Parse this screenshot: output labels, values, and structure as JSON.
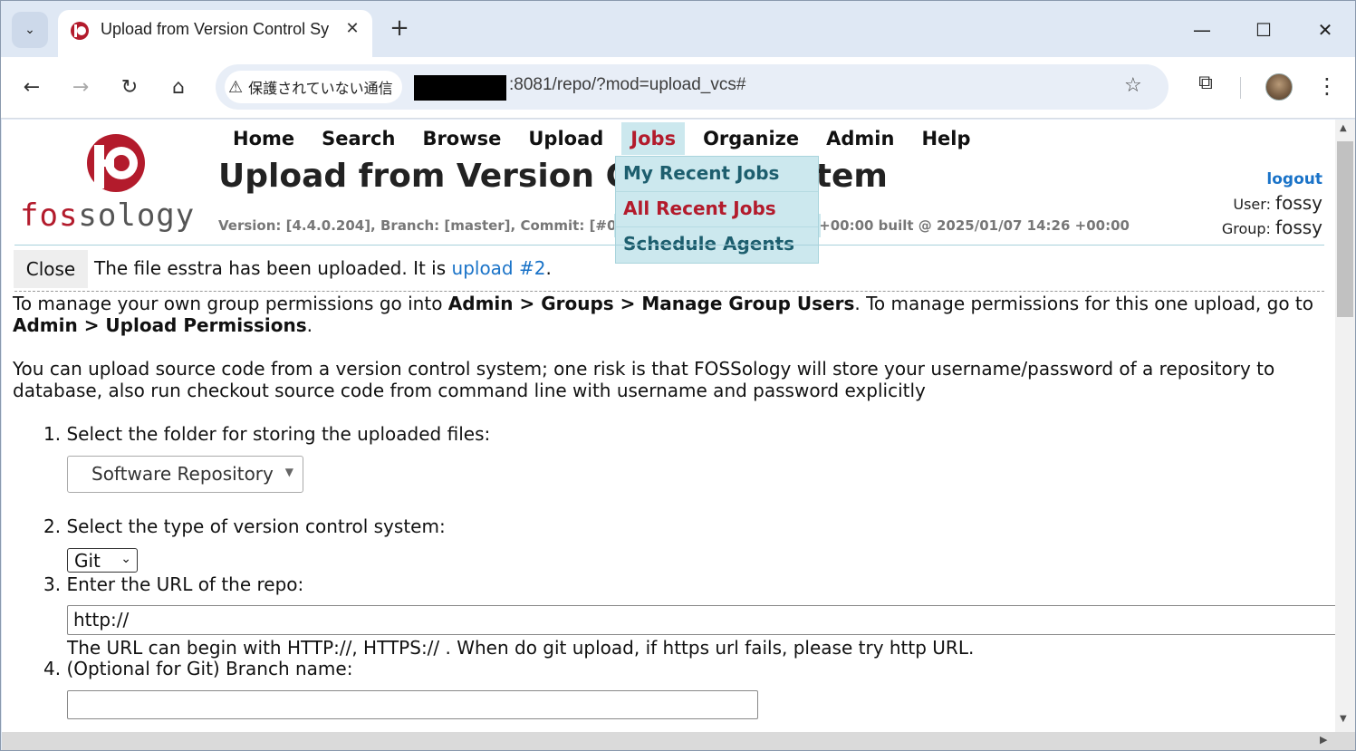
{
  "browser": {
    "tab_title": "Upload from Version Control Sy",
    "security_label": "保護されていない通信",
    "url": ":8081/repo/?mod=upload_vcs#",
    "new_tab": "+",
    "close_tab": "✕"
  },
  "nav": {
    "items": [
      {
        "label": "Home"
      },
      {
        "label": "Search"
      },
      {
        "label": "Browse"
      },
      {
        "label": "Upload"
      },
      {
        "label": "Jobs"
      },
      {
        "label": "Organize"
      },
      {
        "label": "Admin"
      },
      {
        "label": "Help"
      }
    ],
    "jobs_menu": [
      {
        "label": "My Recent Jobs"
      },
      {
        "label": "All Recent Jobs"
      },
      {
        "label": "Schedule Agents"
      }
    ]
  },
  "logo": {
    "text_red": "fos",
    "text_gray": "sology"
  },
  "header": {
    "title": "Upload from Version Control System",
    "version": "Version: [4.4.0.204], Branch: [master], Commit: [#0dfa0d1] 2025/01/07 14:13 +00:00 built @ 2025/01/07 14:26 +00:00",
    "logout": "logout",
    "user_label": "User:",
    "user": "fossy",
    "group_label": "Group:",
    "group": "fossy"
  },
  "notice": {
    "close_label": "Close",
    "text": "The file esstra has been uploaded. It is ",
    "link": "upload #2",
    "end": "."
  },
  "intro": {
    "p1_a": "To manage your own group permissions go into ",
    "p1_b": "Admin > Groups > Manage Group Users",
    "p1_c": ". To manage permissions for this one upload, go to ",
    "p1_d": "Admin > Upload Permissions",
    "p1_e": ".",
    "p2": "You can upload source code from a version control system; one risk is that FOSSology will store your username/password of a repository to database, also run checkout source code from command line with username and password explicitly"
  },
  "form": {
    "step1": "1. Select the folder for storing the uploaded files:",
    "folder_value": "Software Repository",
    "step2": "2. Select the type of version control system:",
    "vcs_value": "Git",
    "step3": "3. Enter the URL of the repo:",
    "url_value": "http://",
    "url_hint": "The URL can begin with HTTP://, HTTPS:// . When do git upload, if https url fails, please try http URL.",
    "step4": "4. (Optional for Git) Branch name:",
    "branch_value": ""
  },
  "colors": {
    "brand_red": "#b31b2c",
    "menu_bg": "#cce8ee",
    "link": "#1a73c8"
  }
}
